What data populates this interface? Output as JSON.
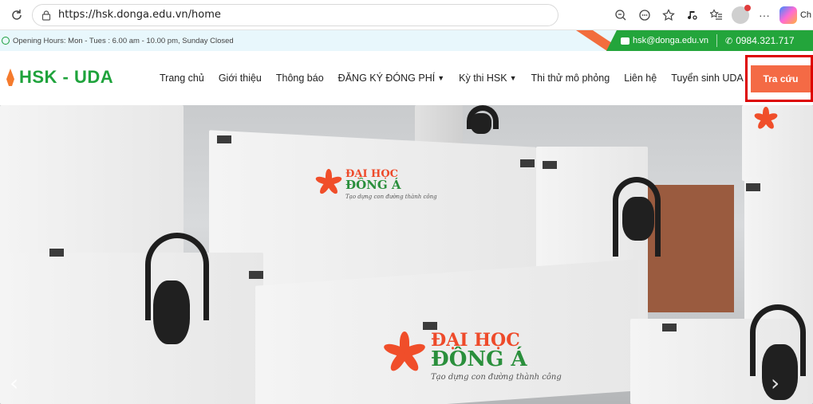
{
  "browser": {
    "url": "https://hsk.donga.edu.vn/home",
    "copilot_label": "Ch"
  },
  "topbar": {
    "hours": "Opening Hours: Mon - Tues : 6.00 am - 10.00 pm, Sunday Closed",
    "email": "hsk@donga.edu.vn",
    "phone": "0984.321.717"
  },
  "header": {
    "logo": "HSK - UDA",
    "nav": [
      {
        "label": "Trang chủ"
      },
      {
        "label": "Giới thiệu"
      },
      {
        "label": "Thông báo"
      },
      {
        "label": "ĐĂNG KÝ ĐÓNG PHÍ",
        "dropdown": true
      },
      {
        "label": "Kỳ thi HSK",
        "dropdown": true
      },
      {
        "label": "Thi thử mô phỏng"
      },
      {
        "label": "Liên hệ"
      },
      {
        "label": "Tuyển sinh UDA"
      }
    ],
    "cta": "Tra cứu"
  },
  "hero": {
    "brand_line1": "ĐẠI HỌC",
    "brand_line2": "ĐÔNG Á",
    "brand_tagline": "Tạo dựng con đường thành công",
    "prev_label": "‹",
    "next_label": "›"
  },
  "colors": {
    "brand_green": "#1fa33c",
    "accent_orange": "#f46a45",
    "highlight_red": "#dd0000",
    "info_bg": "#e8f7fc"
  }
}
